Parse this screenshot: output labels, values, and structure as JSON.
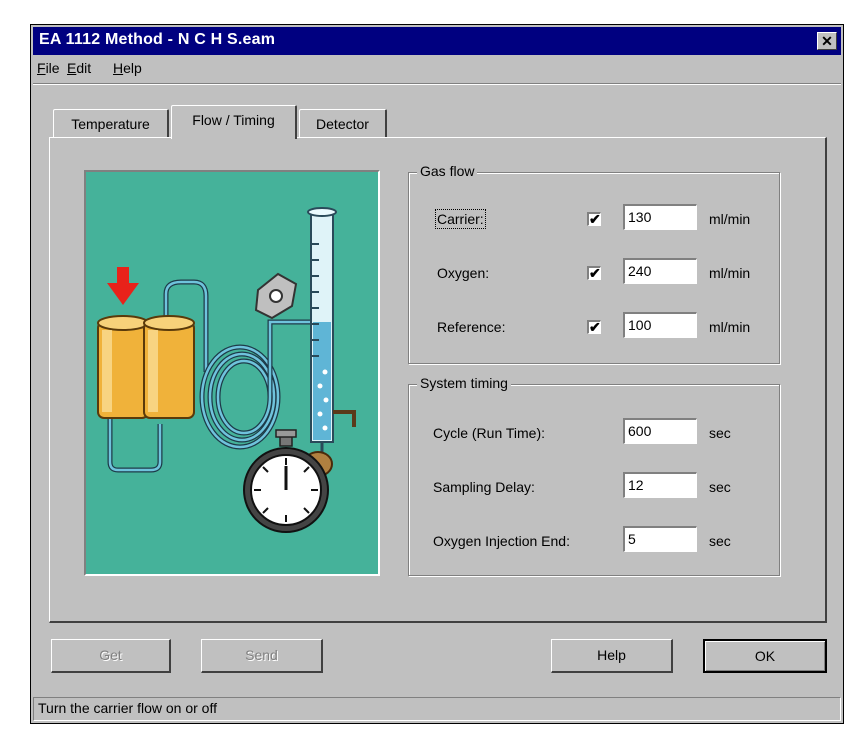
{
  "window": {
    "title": "EA 1112 Method - N C H S.eam"
  },
  "menu": [
    {
      "label": "File",
      "mnemonic": "F",
      "rest": "ile"
    },
    {
      "label": "Edit",
      "mnemonic": "E",
      "rest": "dit"
    },
    {
      "label": "Help",
      "mnemonic": "H",
      "rest": "elp"
    }
  ],
  "tabs": [
    {
      "label": "Temperature",
      "active": false
    },
    {
      "label": "Flow / Timing",
      "active": true
    },
    {
      "label": "Detector",
      "active": false
    }
  ],
  "gas_flow": {
    "title": "Gas flow",
    "rows": [
      {
        "label": "Carrier:",
        "checked": true,
        "value": "130",
        "unit": "ml/min"
      },
      {
        "label": "Oxygen:",
        "checked": true,
        "value": "240",
        "unit": "ml/min"
      },
      {
        "label": "Reference:",
        "checked": true,
        "value": "100",
        "unit": "ml/min"
      }
    ]
  },
  "system_timing": {
    "title": "System timing",
    "rows": [
      {
        "label": "Cycle (Run Time):",
        "value": "600",
        "unit": "sec"
      },
      {
        "label": "Sampling Delay:",
        "value": "12",
        "unit": "sec"
      },
      {
        "label": "Oxygen Injection End:",
        "value": "5",
        "unit": "sec"
      }
    ]
  },
  "buttons": {
    "get": "Get",
    "send": "Send",
    "help": "Help",
    "ok": "OK"
  },
  "status": "Turn the carrier flow on or off",
  "check_glyph": "✔",
  "colors": {
    "titlebar": "#000080",
    "face": "#c0c0c0",
    "illustration_bg": "#45b29a"
  }
}
